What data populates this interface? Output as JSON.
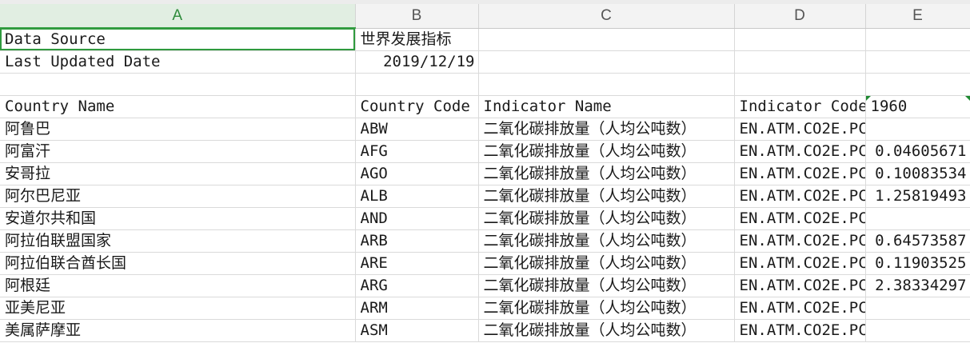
{
  "sheet": {
    "columns": [
      "A",
      "B",
      "C",
      "D",
      "E"
    ],
    "selected_column": "A",
    "meta": {
      "source_label": "Data Source",
      "source_value": "世界发展指标",
      "updated_label": "Last Updated Date",
      "updated_value": "2019/12/19"
    },
    "headers": [
      "Country Name",
      "Country Code",
      "Indicator Name",
      "Indicator Code",
      "1960"
    ],
    "rows": [
      [
        "阿鲁巴",
        "ABW",
        "二氧化碳排放量（人均公吨数）",
        "EN.ATM.CO2E.PC",
        ""
      ],
      [
        "阿富汗",
        "AFG",
        "二氧化碳排放量（人均公吨数）",
        "EN.ATM.CO2E.PC",
        "0.04605671"
      ],
      [
        "安哥拉",
        "AGO",
        "二氧化碳排放量（人均公吨数）",
        "EN.ATM.CO2E.PC",
        "0.10083534"
      ],
      [
        "阿尔巴尼亚",
        "ALB",
        "二氧化碳排放量（人均公吨数）",
        "EN.ATM.CO2E.PC",
        "1.25819493"
      ],
      [
        "安道尔共和国",
        "AND",
        "二氧化碳排放量（人均公吨数）",
        "EN.ATM.CO2E.PC",
        ""
      ],
      [
        "阿拉伯联盟国家",
        "ARB",
        "二氧化碳排放量（人均公吨数）",
        "EN.ATM.CO2E.PC",
        "0.64573587"
      ],
      [
        "阿拉伯联合酋长国",
        "ARE",
        "二氧化碳排放量（人均公吨数）",
        "EN.ATM.CO2E.PC",
        "0.11903525"
      ],
      [
        "阿根廷",
        "ARG",
        "二氧化碳排放量（人均公吨数）",
        "EN.ATM.CO2E.PC",
        "2.38334297"
      ],
      [
        "亚美尼亚",
        "ARM",
        "二氧化碳排放量（人均公吨数）",
        "EN.ATM.CO2E.PC",
        ""
      ],
      [
        "美属萨摩亚",
        "ASM",
        "二氧化碳排放量（人均公吨数）",
        "EN.ATM.CO2E.PC",
        ""
      ]
    ],
    "colors": {
      "selection_green": "#2f9a3e",
      "header_bg": "#f3f3f3",
      "selected_header_bg": "#e1eee2",
      "gridline": "#dadada"
    }
  }
}
